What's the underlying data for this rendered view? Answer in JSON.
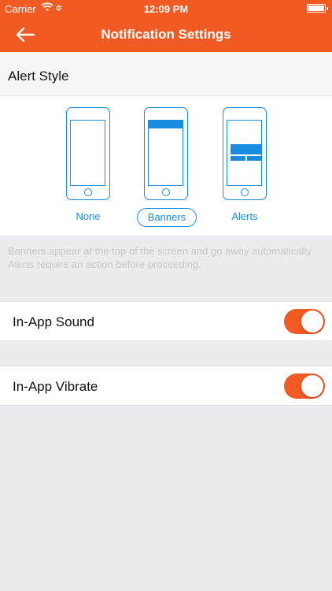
{
  "status_bar": {
    "carrier": "Carrier",
    "time": "12:09 PM"
  },
  "nav": {
    "title": "Notification Settings",
    "back_icon": "back-arrow-icon"
  },
  "alert_style": {
    "header": "Alert Style",
    "options": [
      {
        "label": "None",
        "selected": false
      },
      {
        "label": "Banners",
        "selected": true
      },
      {
        "label": "Alerts",
        "selected": false
      }
    ],
    "description": "Banners appear at the top of the screen and go away automatically. Alerts require an action before proceeding."
  },
  "settings": [
    {
      "label": "In-App Sound",
      "on": true
    },
    {
      "label": "In-App Vibrate",
      "on": true
    }
  ],
  "colors": {
    "accent": "#f25a23",
    "selection": "#1a8ce0",
    "background": "#ebebf0"
  }
}
